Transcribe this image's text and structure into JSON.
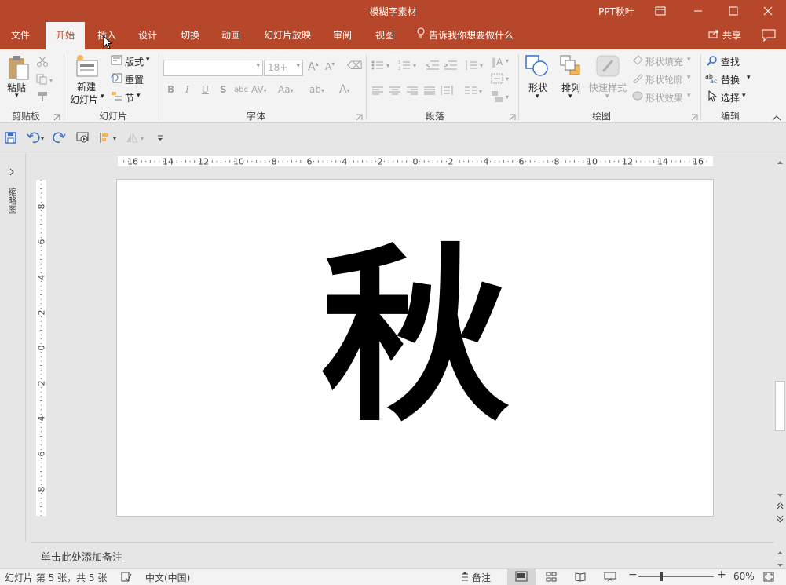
{
  "window": {
    "title": "模糊字素材",
    "user": "PPT秋叶"
  },
  "tabs": [
    {
      "label": "文件"
    },
    {
      "label": "开始"
    },
    {
      "label": "插入"
    },
    {
      "label": "设计"
    },
    {
      "label": "切换"
    },
    {
      "label": "动画"
    },
    {
      "label": "幻灯片放映"
    },
    {
      "label": "审阅"
    },
    {
      "label": "视图"
    }
  ],
  "tell_me": "告诉我你想要做什么",
  "share": "共享",
  "ribbon": {
    "clipboard": {
      "paste": "粘贴",
      "label": "剪贴板"
    },
    "slides": {
      "new_line1": "新建",
      "new_line2": "幻灯片",
      "layout": "版式",
      "reset": "重置",
      "section": "节",
      "label": "幻灯片"
    },
    "font": {
      "font_name": "",
      "font_size": "18+",
      "label": "字体"
    },
    "paragraph": {
      "label": "段落"
    },
    "drawing": {
      "shapes": "形状",
      "arrange": "排列",
      "quick_styles": "快速样式",
      "shape_fill": "形状填充",
      "shape_outline": "形状轮廓",
      "shape_effects": "形状效果",
      "label": "绘图"
    },
    "editing": {
      "find": "查找",
      "replace": "替换",
      "select": "选择",
      "label": "编辑"
    }
  },
  "side_panel": {
    "label": "缩略图"
  },
  "rulers": {
    "h_ticks": [
      "16",
      "14",
      "12",
      "10",
      "8",
      "6",
      "4",
      "2",
      "0",
      "2",
      "4",
      "6",
      "8",
      "10",
      "12",
      "14",
      "16"
    ],
    "v_ticks": [
      "8",
      "6",
      "4",
      "2",
      "0",
      "2",
      "4",
      "6",
      "8"
    ]
  },
  "slide": {
    "text": "秋"
  },
  "notes": {
    "placeholder": "单击此处添加备注"
  },
  "status": {
    "slide_info": "幻灯片 第 5 张，共 5 张",
    "language": "中文(中国)",
    "notes_btn": "备注",
    "zoom": "60%"
  },
  "colors": {
    "accent": "#b7472a",
    "ribbon_bg": "#f3f3f3"
  }
}
